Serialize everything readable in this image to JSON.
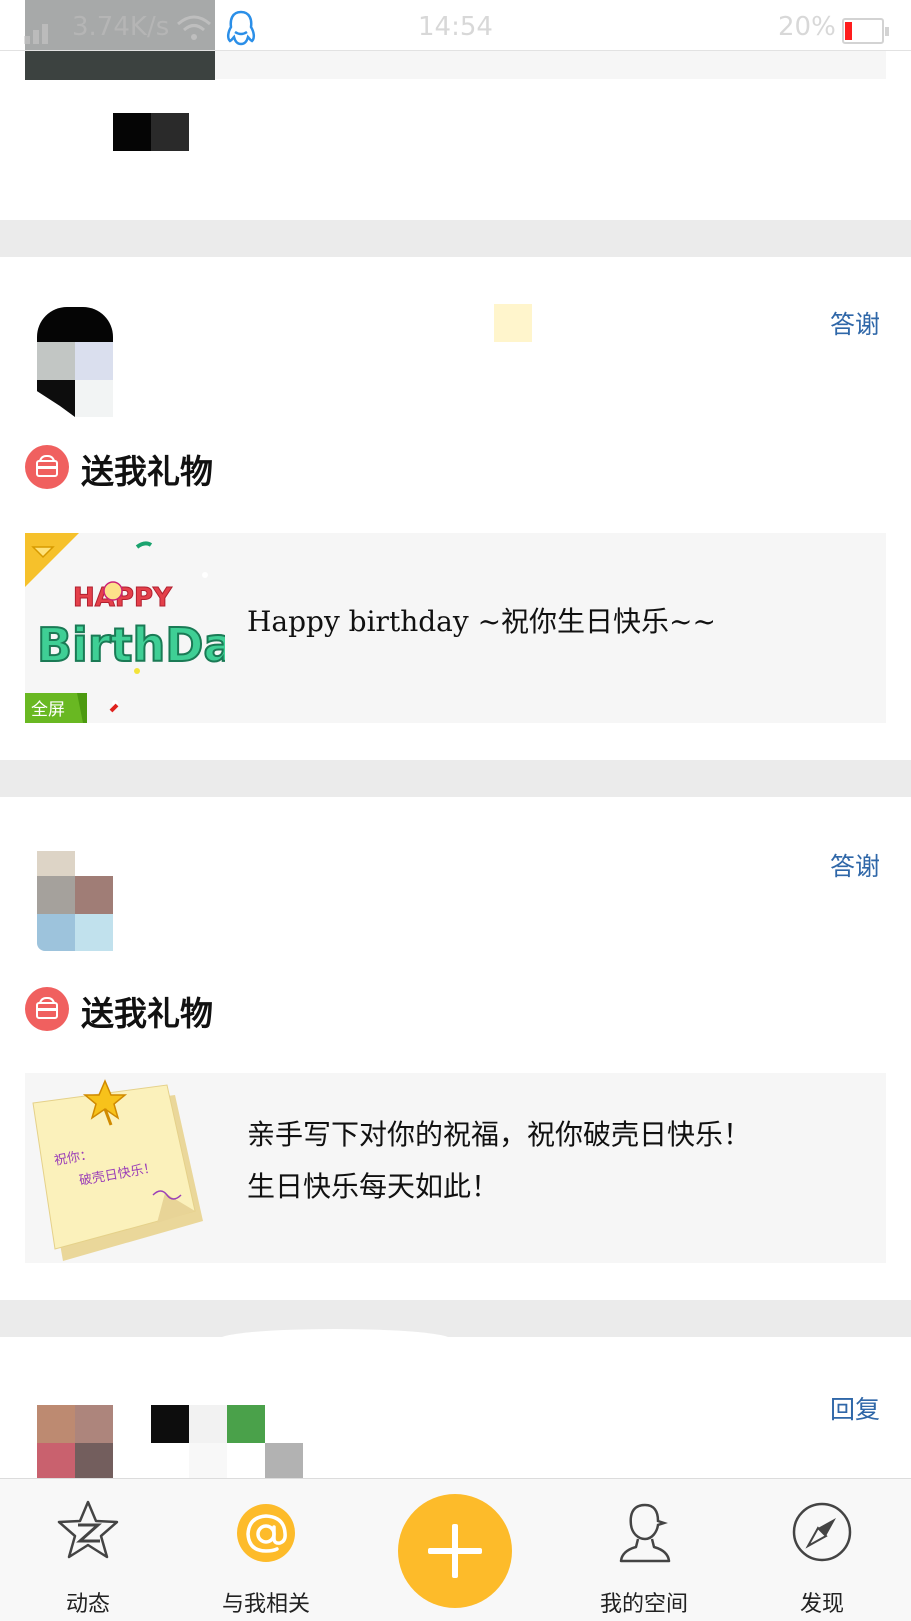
{
  "status_bar": {
    "net_speed": "3.74K/s",
    "time": "14:54",
    "battery": "20%",
    "battery_level": 0.2,
    "battery_color": "#ff1d1d"
  },
  "feed": [
    {
      "reply_label": "答谢",
      "action_label": "送我礼物",
      "gift_message": "Happy birthday ~祝你生日快乐~~",
      "gift_badge": "全屏",
      "gift_art_text": "HAPPY BirthDay"
    },
    {
      "reply_label": "答谢",
      "action_label": "送我礼物",
      "gift_message_line1": "亲手写下对你的祝福，祝你破壳日快乐！",
      "gift_message_line2": "生日快乐每天如此！",
      "note_text_1": "祝你：",
      "note_text_2": "破壳日快乐！"
    },
    {
      "reply_label": "回复"
    }
  ],
  "bottom_nav": {
    "items": [
      {
        "label": "动态",
        "icon": "qzone-star-icon"
      },
      {
        "label": "与我相关",
        "icon": "at-icon"
      },
      {
        "label": "",
        "icon": "plus-icon"
      },
      {
        "label": "我的空间",
        "icon": "profile-bust-icon"
      },
      {
        "label": "发现",
        "icon": "compass-icon"
      }
    ],
    "accent_color": "#fdbb2a"
  },
  "colors": {
    "separator": "#ebebeb",
    "link": "#2f67a8",
    "gift_icon": "#f0605f"
  }
}
